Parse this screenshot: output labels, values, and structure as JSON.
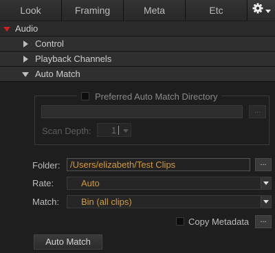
{
  "tabs": [
    {
      "label": "Look"
    },
    {
      "label": "Framing"
    },
    {
      "label": "Meta"
    },
    {
      "label": "Etc"
    }
  ],
  "sections": {
    "audio": {
      "label": "Audio"
    },
    "control": {
      "label": "Control"
    },
    "playback": {
      "label": "Playback Channels"
    },
    "auto_match": {
      "label": "Auto Match"
    }
  },
  "preferred_dir": {
    "checkbox_label": "Preferred Auto Match Directory",
    "checked": false,
    "path_value": "",
    "browse_label": "...",
    "scan_depth_label": "Scan Depth:",
    "scan_depth_value": "1"
  },
  "folder": {
    "label": "Folder:",
    "value": "/Users/elizabeth/Test Clips",
    "browse_label": "..."
  },
  "rate": {
    "label": "Rate:",
    "value": "Auto"
  },
  "match": {
    "label": "Match:",
    "value": "Bin (all clips)"
  },
  "copy_metadata": {
    "label": "Copy Metadata",
    "checked": false,
    "browse_label": "..."
  },
  "auto_match_button": {
    "label": "Auto Match"
  },
  "colors": {
    "accent_value": "#d49a3a",
    "expand_triangle": "#d01f1f",
    "background": "#1f1f1f"
  },
  "icons": {
    "settings": "gear-icon",
    "settings_menu": "caret-down-icon"
  }
}
